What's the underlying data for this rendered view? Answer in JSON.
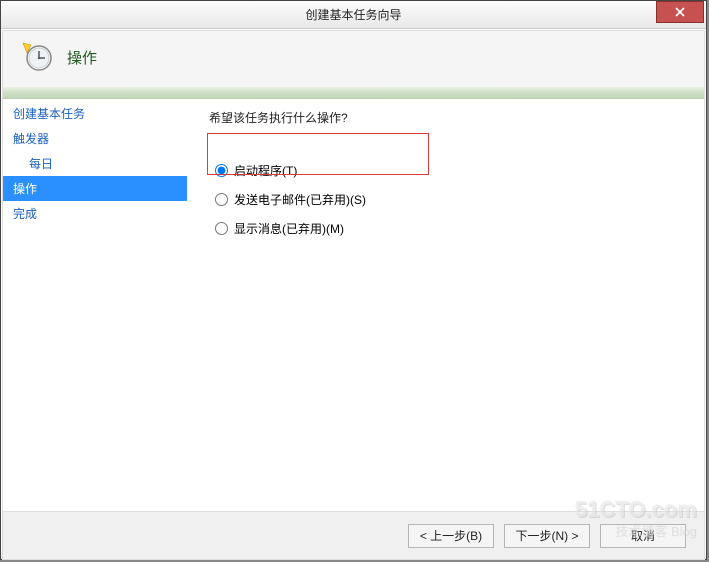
{
  "titlebar": {
    "title": "创建基本任务向导"
  },
  "header": {
    "title": "操作"
  },
  "sidebar": {
    "items": [
      {
        "label": "创建基本任务",
        "indent": false,
        "selected": false
      },
      {
        "label": "触发器",
        "indent": false,
        "selected": false
      },
      {
        "label": "每日",
        "indent": true,
        "selected": false
      },
      {
        "label": "操作",
        "indent": false,
        "selected": true
      },
      {
        "label": "完成",
        "indent": false,
        "selected": false
      }
    ]
  },
  "main": {
    "question": "希望该任务执行什么操作?",
    "options": [
      {
        "label": "启动程序(T)",
        "checked": true
      },
      {
        "label": "发送电子邮件(已弃用)(S)",
        "checked": false
      },
      {
        "label": "显示消息(已弃用)(M)",
        "checked": false
      }
    ]
  },
  "footer": {
    "back": "< 上一步(B)",
    "next": "下一步(N) >",
    "cancel": "取消"
  },
  "watermark": {
    "line1": "51CTO.com",
    "line2": "技术博客 Blog"
  }
}
